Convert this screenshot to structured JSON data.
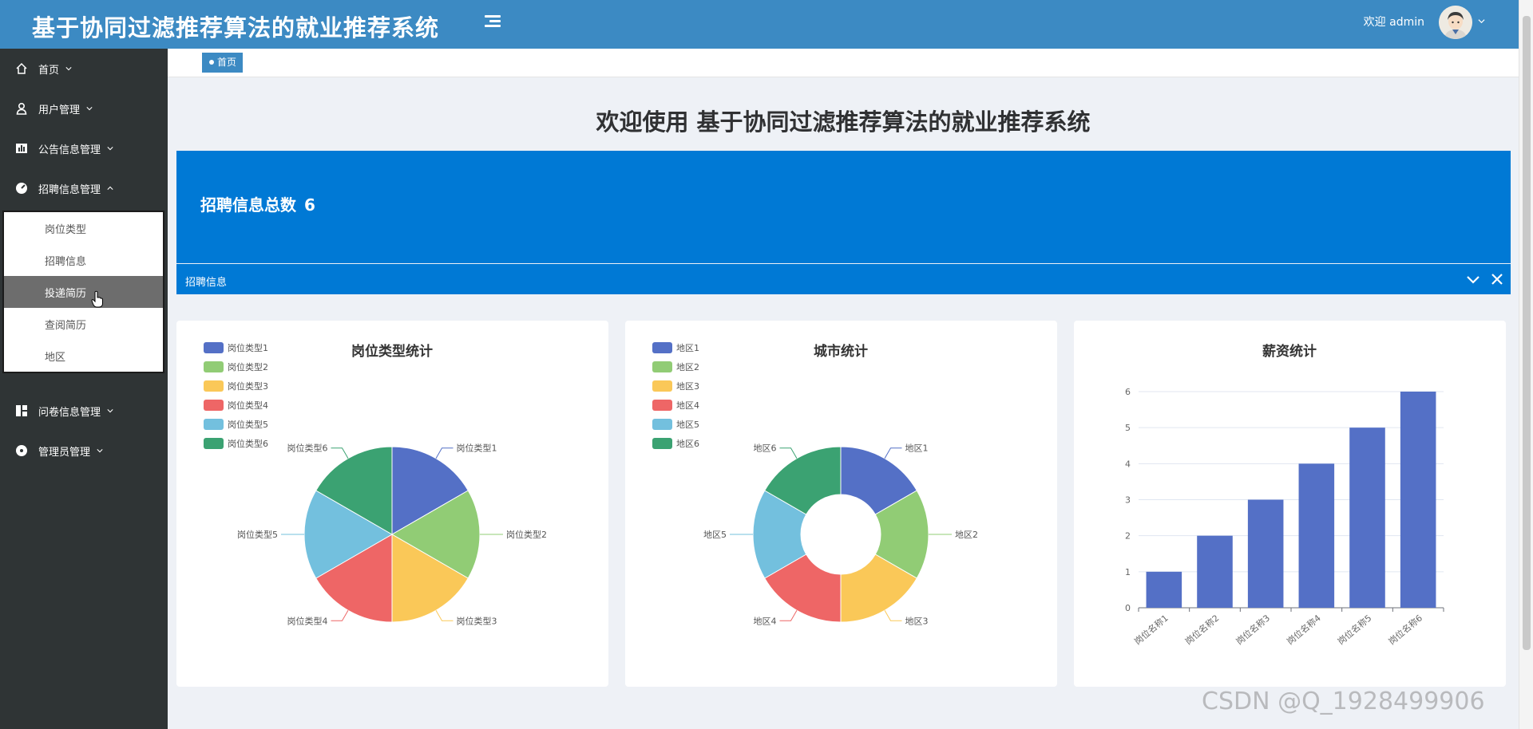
{
  "header": {
    "title": "基于协同过滤推荐算法的就业推荐系统",
    "welcome": "欢迎 admin"
  },
  "sidebar": {
    "items": [
      {
        "label": "首页",
        "icon": "home-icon",
        "expanded": false
      },
      {
        "label": "用户管理",
        "icon": "user-icon",
        "expanded": false
      },
      {
        "label": "公告信息管理",
        "icon": "bar-chart-icon",
        "expanded": false
      },
      {
        "label": "招聘信息管理",
        "icon": "dashboard-icon",
        "expanded": true
      },
      {
        "label": "问卷信息管理",
        "icon": "layout-icon",
        "expanded": false
      },
      {
        "label": "管理员管理",
        "icon": "circle-dot-icon",
        "expanded": false
      }
    ],
    "submenu": [
      {
        "label": "岗位类型",
        "active": false
      },
      {
        "label": "招聘信息",
        "active": false
      },
      {
        "label": "投递简历",
        "active": true
      },
      {
        "label": "查阅简历",
        "active": false
      },
      {
        "label": "地区",
        "active": false
      }
    ]
  },
  "breadcrumb": {
    "label": "首页"
  },
  "main": {
    "welcome_title": "欢迎使用 基于协同过滤推荐算法的就业推荐系统",
    "stat": {
      "label": "招聘信息总数",
      "value": "6",
      "footer": "招聘信息"
    }
  },
  "colors": {
    "header": "#3c8ac3",
    "sidebar": "#2f3435",
    "stat_card": "#0079d5",
    "palette": [
      "#5470c6",
      "#91cc75",
      "#fac858",
      "#ee6666",
      "#73c0de",
      "#3ba272"
    ]
  },
  "chart_data": [
    {
      "type": "pie",
      "title": "岗位类型统计",
      "categories": [
        "岗位类型1",
        "岗位类型2",
        "岗位类型3",
        "岗位类型4",
        "岗位类型5",
        "岗位类型6"
      ],
      "values": [
        1,
        1,
        1,
        1,
        1,
        1
      ],
      "legend": "top-left"
    },
    {
      "type": "pie",
      "subtype": "donut",
      "title": "城市统计",
      "categories": [
        "地区1",
        "地区2",
        "地区3",
        "地区4",
        "地区5",
        "地区6"
      ],
      "values": [
        1,
        1,
        1,
        1,
        1,
        1
      ],
      "legend": "top-left"
    },
    {
      "type": "bar",
      "title": "薪资统计",
      "categories": [
        "岗位名称1",
        "岗位名称2",
        "岗位名称3",
        "岗位名称4",
        "岗位名称5",
        "岗位名称6"
      ],
      "values": [
        1,
        2,
        3,
        4,
        5,
        6
      ],
      "yticks": [
        "0",
        "1",
        "2",
        "3",
        "4",
        "5",
        "6"
      ],
      "ylim": [
        0,
        6
      ]
    }
  ],
  "watermark": "CSDN @Q_1928499906"
}
